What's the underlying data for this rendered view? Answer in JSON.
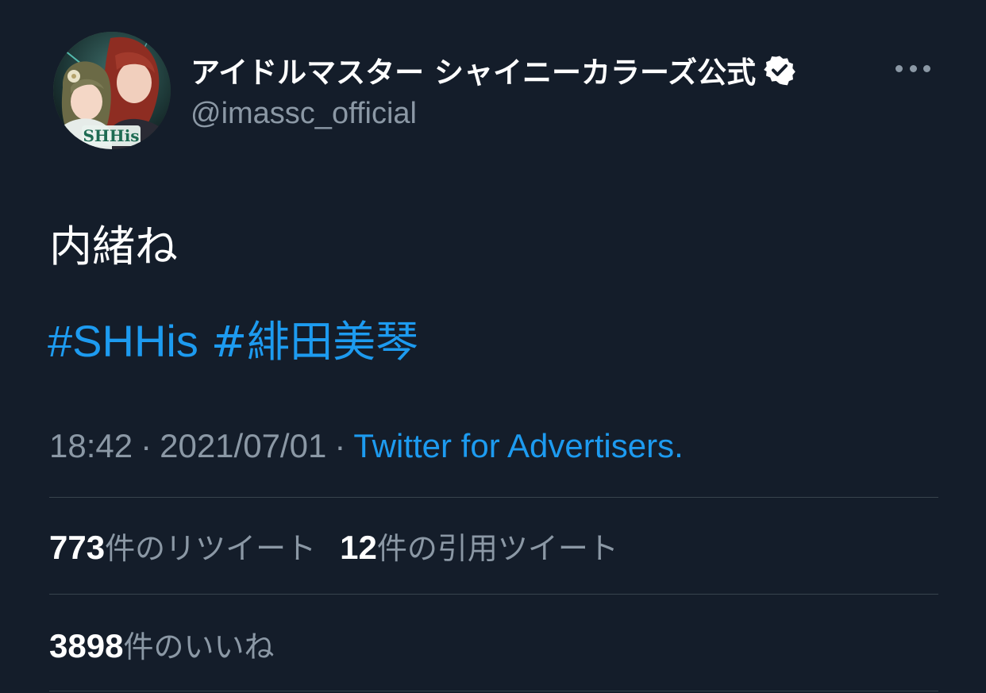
{
  "author": {
    "display_name": "アイドルマスター シャイニーカラーズ公式",
    "handle": "@imassc_official",
    "avatar_text": "SHHis"
  },
  "tweet": {
    "text": "内緒ね",
    "hashtags": [
      "#SHHis",
      "#緋田美琴"
    ],
    "time": "18:42",
    "date": "2021/07/01",
    "separator": "·",
    "source": "Twitter for Advertisers."
  },
  "stats": {
    "retweets_count": "773",
    "retweets_label": "件のリツイート",
    "quotes_count": "12",
    "quotes_label": "件の引用ツイート",
    "likes_count": "3898",
    "likes_label": "件のいいね"
  },
  "colors": {
    "background": "#141d2a",
    "link": "#1d9bf0",
    "secondary_text": "#8b98a5",
    "divider": "#38444d"
  },
  "icons": {
    "verified": "verified-badge-icon",
    "more": "more-horizontal-icon"
  }
}
